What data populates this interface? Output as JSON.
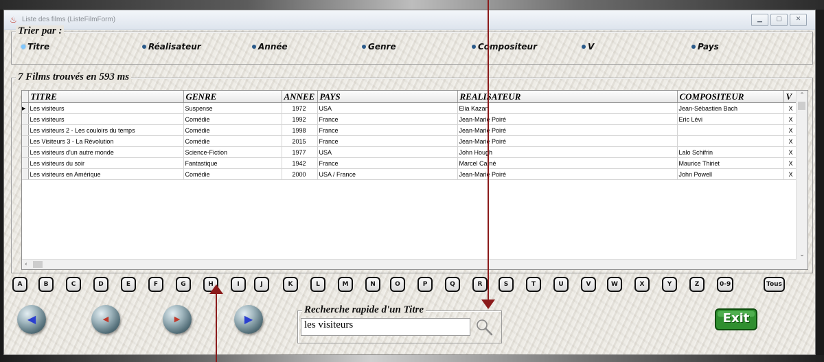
{
  "window": {
    "title": "Liste des films (ListeFilmForm)"
  },
  "sort": {
    "legend": "Trier par :",
    "options": [
      "Titre",
      "Réalisateur",
      "Année",
      "Genre",
      "Compositeur",
      "V",
      "Pays"
    ],
    "selected": "Titre"
  },
  "results": {
    "legend": "7 Films trouvés en 593 ms"
  },
  "table": {
    "columns": [
      "TITRE",
      "GENRE",
      "ANNEE",
      "PAYS",
      "REALISATEUR",
      "COMPOSITEUR",
      "V"
    ],
    "rows": [
      [
        "Les visiteurs",
        "Suspense",
        "1972",
        "USA",
        "Elia Kazan",
        "Jean-Sébastien Bach",
        "X"
      ],
      [
        "Les visiteurs",
        "Comédie",
        "1992",
        "France",
        "Jean-Marie Poiré",
        "Eric Lévi",
        "X"
      ],
      [
        "Les visiteurs 2 - Les couloirs du temps",
        "Comédie",
        "1998",
        "France",
        "Jean-Marie Poiré",
        "",
        "X"
      ],
      [
        "Les Visiteurs 3 - La Révolution",
        "Comédie",
        "2015",
        "France",
        "Jean-Marie Poiré",
        "",
        "X"
      ],
      [
        "Les visiteurs d'un autre monde",
        "Science-Fiction",
        "1977",
        "USA",
        "John Hough",
        "Lalo Schifrin",
        "X"
      ],
      [
        "Les visiteurs du soir",
        "Fantastique",
        "1942",
        "France",
        "Marcel Carné",
        "Maurice Thiriet",
        "X"
      ],
      [
        "Les visiteurs en Amérique",
        "Comédie",
        "2000",
        "USA / France",
        "Jean-Marie Poiré",
        "John Powell",
        "X"
      ]
    ]
  },
  "letters": [
    "A",
    "B",
    "C",
    "D",
    "E",
    "F",
    "G",
    "H",
    "I",
    "J",
    "K",
    "L",
    "M",
    "N",
    "O",
    "P",
    "Q",
    "R",
    "S",
    "T",
    "U",
    "V",
    "W",
    "X",
    "Y",
    "Z",
    "0-9",
    "Tous"
  ],
  "search": {
    "legend": "Recherche rapide d'un Titre",
    "value": "les visiteurs"
  },
  "exit": {
    "label": "Exit"
  },
  "colors": {
    "annotation_arrow": "#8b1a1a",
    "exit_green": "#2f8f2f"
  },
  "icons": {
    "nav": [
      "first-arrow-icon",
      "prev-arrow-icon",
      "next-arrow-icon",
      "last-arrow-icon"
    ],
    "search": "magnifier-icon"
  }
}
